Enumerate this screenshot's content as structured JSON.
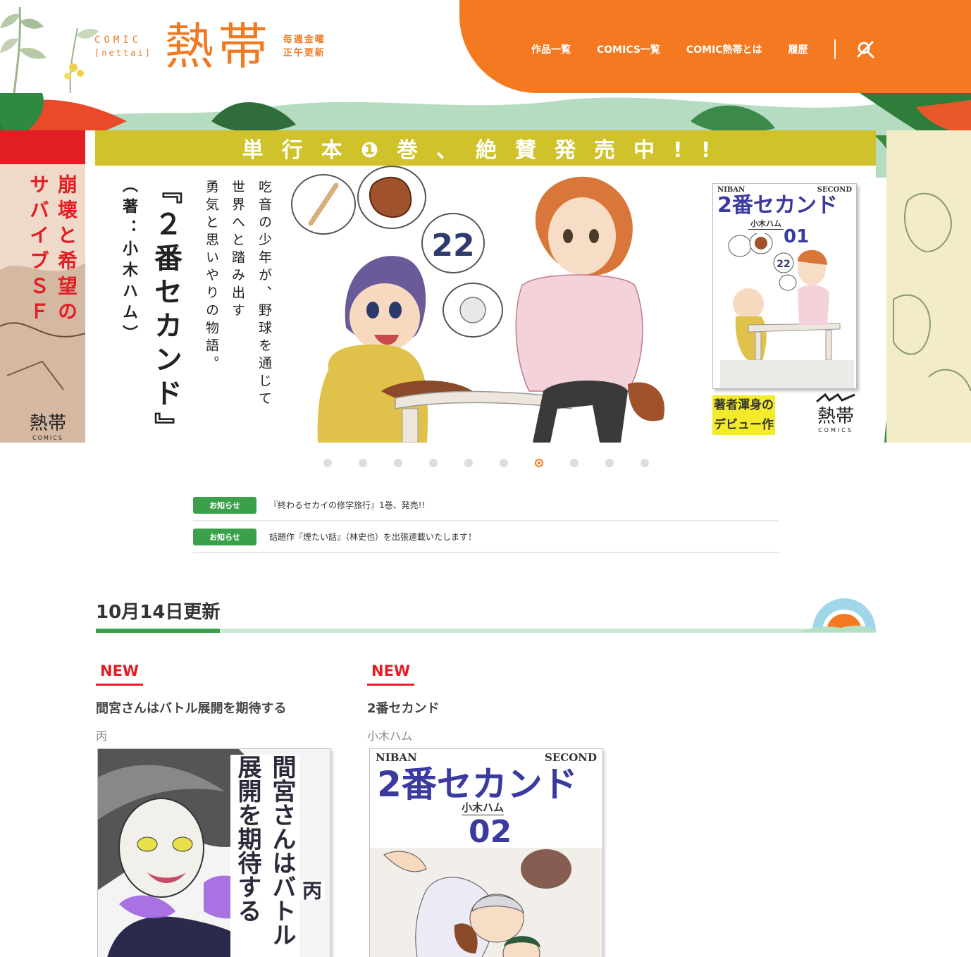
{
  "header": {
    "logo": {
      "comic_line1": "COMIC",
      "comic_line2": "[nettai]",
      "kanji": "熱帯",
      "weekly_line1": "毎週金曜",
      "weekly_line2": "正午更新"
    },
    "nav": [
      {
        "label": "作品一覧"
      },
      {
        "label": "COMICS一覧"
      },
      {
        "label": "COMIC熱帯とは"
      },
      {
        "label": "履歴"
      }
    ],
    "search_icon": "search-icon"
  },
  "hero": {
    "left_banner_text_1": "崩壊と希望の",
    "left_banner_text_2": "サバイブＳＦ",
    "left_banner_logo": "熱帯",
    "left_banner_logo_sub": "COMICS",
    "headline": "単行本❶巻、絶賛発売中!!",
    "desc_line1": "吃音の少年が、野球を通じて",
    "desc_line2": "世界へと踏み出す",
    "desc_line3": "勇気と思いやりの物語。",
    "title": "『２番セカンド』",
    "author": "（著：小木ハム）",
    "cover": {
      "niban": "NIBAN",
      "second": "SECOND",
      "title": "2番セカンド",
      "author": "小木ハム",
      "volume": "01",
      "bubble_number": "22"
    },
    "debut_line1": "著者渾身の",
    "debut_line2": "デビュー作",
    "logo": "熱帯",
    "logo_sub": "COMICS",
    "slides_total": 10,
    "active_slide": 7
  },
  "news": [
    {
      "tag": "お知らせ",
      "text": "『終わるセカイの修学旅行』1巻、発売!!"
    },
    {
      "tag": "お知らせ",
      "text": "話題作『煙たい話』（林史也）を出張連載いたします！"
    }
  ],
  "update": {
    "title": "10月14日更新",
    "cards": [
      {
        "badge": "NEW",
        "title": "間宮さんはバトル展開を期待する",
        "author": "丙",
        "cover_title": "間宮さんはバトル展開を期待する",
        "cover_author": "丙"
      },
      {
        "badge": "NEW",
        "title": "2番セカンド",
        "author": "小木ハム",
        "cover_niban": "NIBAN",
        "cover_second": "SECOND",
        "cover_title": "2番セカンド",
        "cover_author": "小木ハム",
        "cover_volume": "02"
      }
    ]
  },
  "colors": {
    "brand_orange": "#f47920",
    "accent_green": "#3aa14a",
    "new_red": "#e21d24",
    "banner_yellow": "#cfc22a"
  }
}
